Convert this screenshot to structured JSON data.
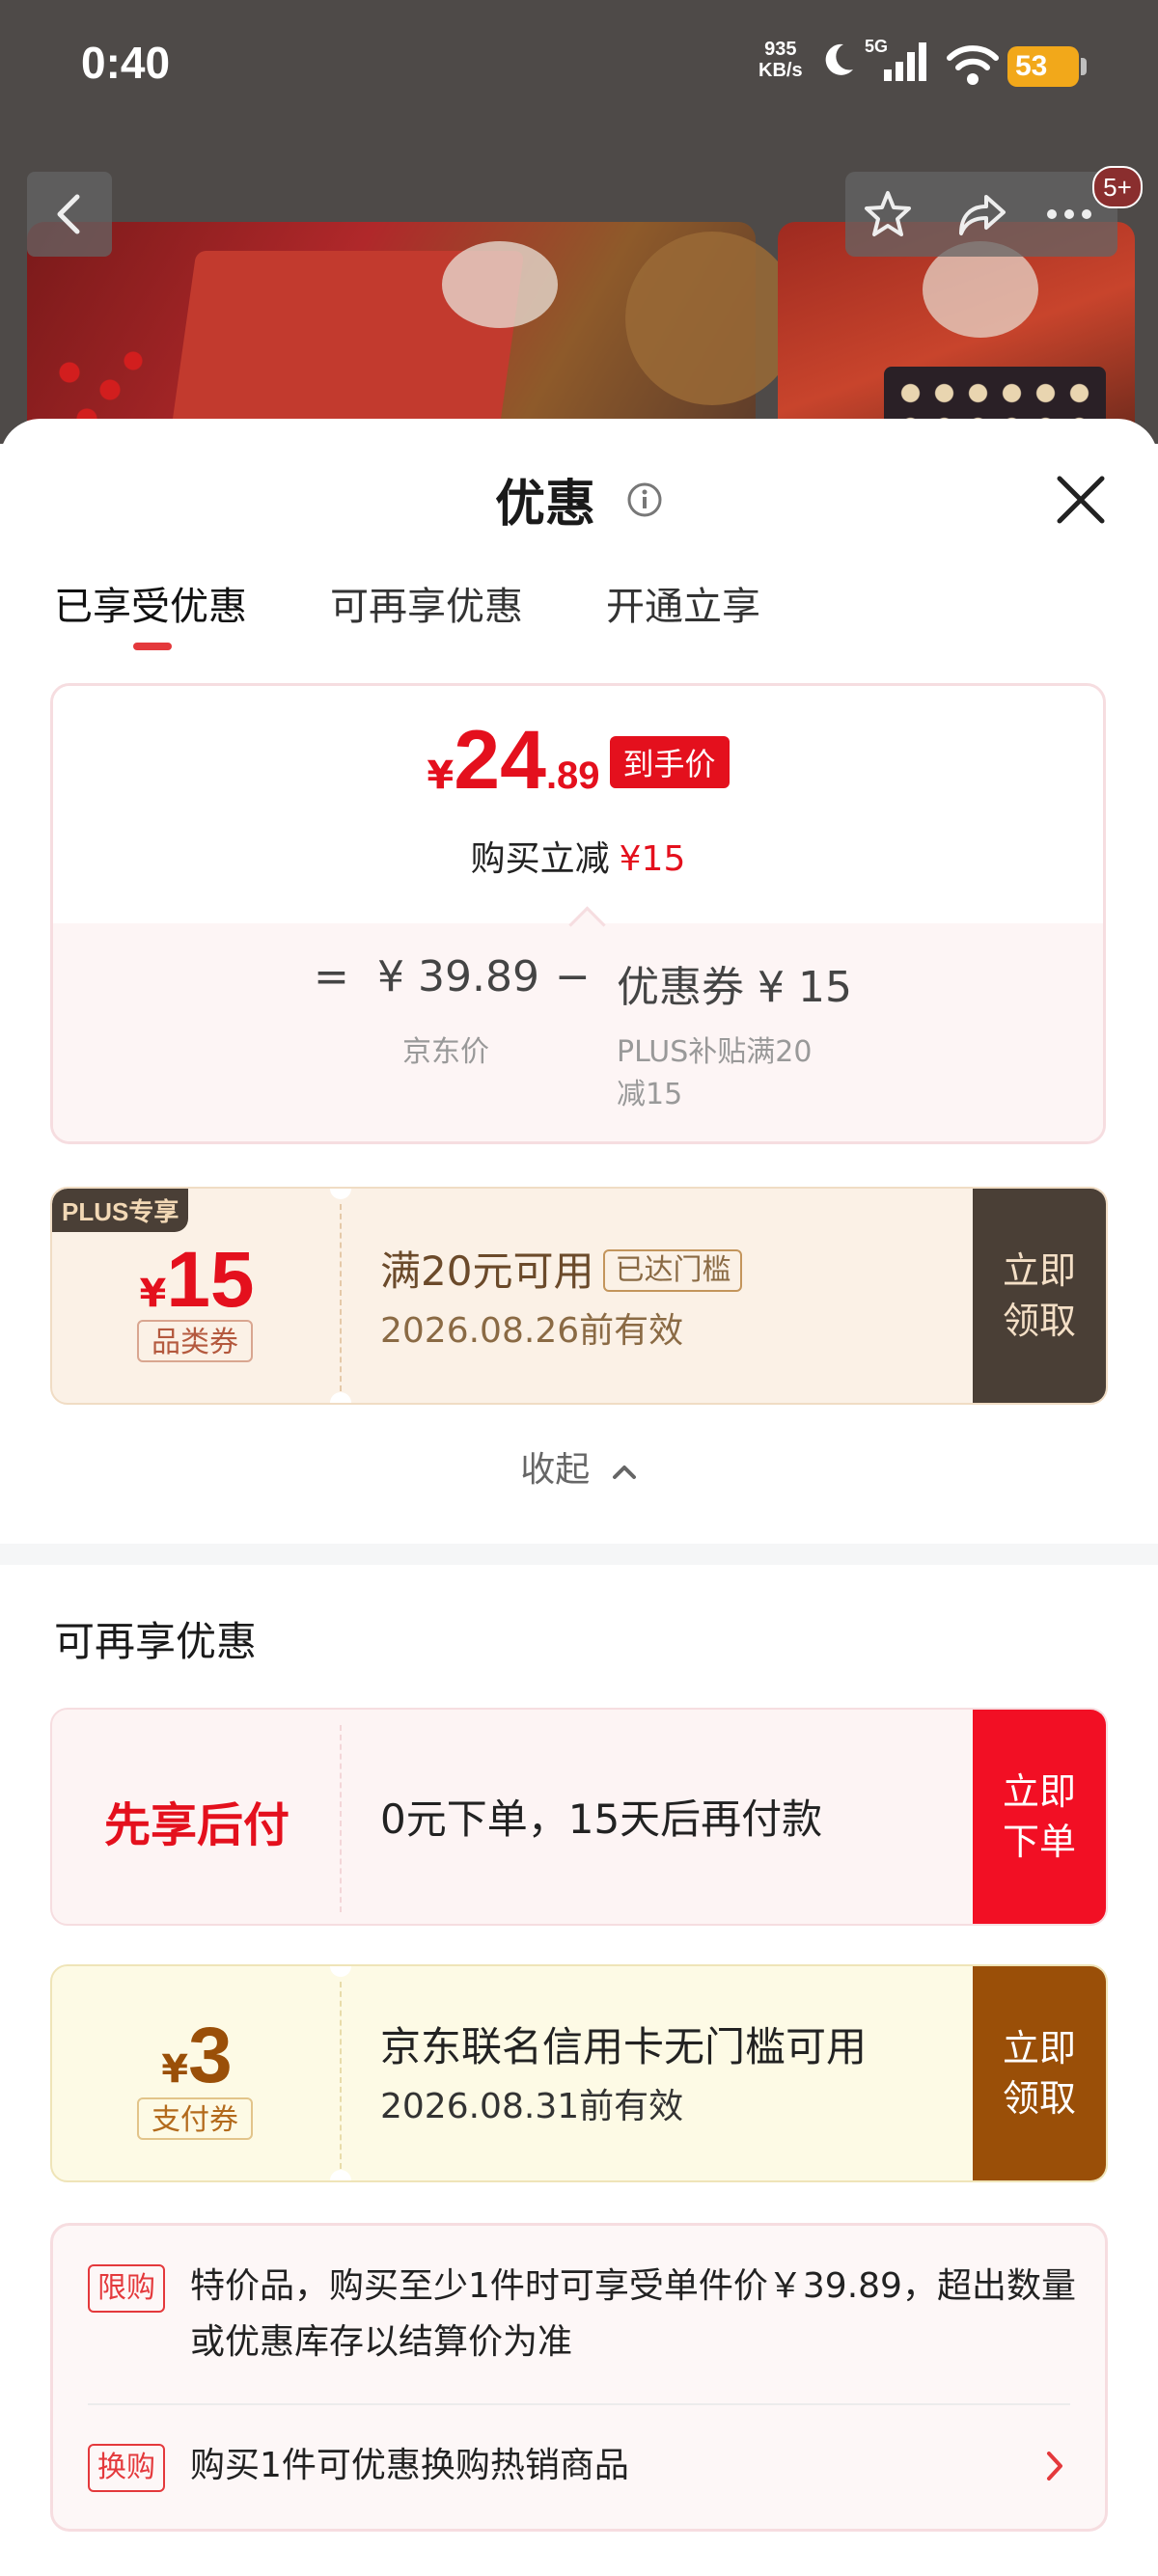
{
  "status_bar": {
    "time": "0:40",
    "net_speed": "935",
    "net_unit": "KB/s",
    "network": "5G",
    "battery": "53",
    "icons": [
      "moon-icon",
      "signal-icon",
      "wifi-icon",
      "battery-icon"
    ]
  },
  "product_page": {
    "badge_count": "5+",
    "icons": [
      "back-icon",
      "star-icon",
      "share-icon",
      "more-icon"
    ]
  },
  "sheet": {
    "title": "优惠",
    "tabs": [
      {
        "label": "已享受优惠",
        "active": true
      },
      {
        "label": "可再享优惠",
        "active": false
      },
      {
        "label": "开通立享",
        "active": false
      }
    ],
    "summary": {
      "currency": "¥",
      "price_int": "24",
      "price_dec": ".89",
      "price_tag": "到手价",
      "save_label": "购买立减",
      "save_value": "¥15",
      "eq": "=",
      "jd_price": "¥ 39.89",
      "jd_price_label": "京东价",
      "minus": "−",
      "coupon_label": "优惠券 ¥ 15",
      "coupon_desc_1": "PLUS补贴满20",
      "coupon_desc_2": "减15"
    },
    "plus_coupon": {
      "corner": "PLUS专享",
      "currency": "¥",
      "amount": "15",
      "type": "品类券",
      "condition": "满20元可用",
      "reached": "已达门槛",
      "valid": "2026.08.26前有效",
      "button": "立即\n领取"
    },
    "collapse_label": "收起",
    "more_section_title": "可再享优惠",
    "pay_later": {
      "title": "先享后付",
      "desc": "0元下单，15天后再付款",
      "button": "立即\n下单"
    },
    "pay_coupon": {
      "currency": "¥",
      "amount": "3",
      "type": "支付券",
      "desc": "京东联名信用卡无门槛可用",
      "valid": "2026.08.31前有效",
      "button": "立即\n领取"
    },
    "notes": [
      {
        "tag": "限购",
        "text": "特价品，购买至少1件时可享受单件价￥39.89，超出数量或优惠库存以结算价为准"
      },
      {
        "tag": "换购",
        "text": "购买1件可优惠换购热销商品"
      }
    ]
  },
  "colors": {
    "accent_red": "#e4101d",
    "plus_dark": "#4a3f36",
    "pay_brown": "#9a4f08",
    "coupon_bg": "#fbf1e6",
    "pay_bg": "#fdfae5"
  }
}
